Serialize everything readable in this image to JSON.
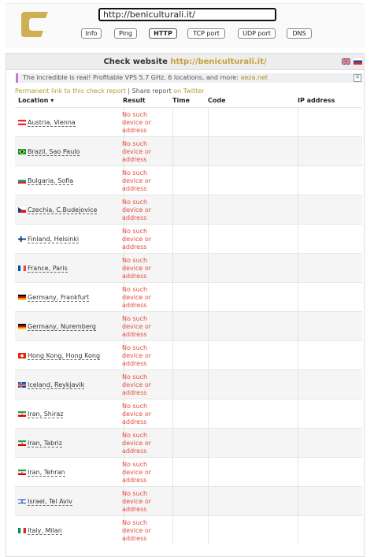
{
  "search": {
    "value": "http://beniculturali.it/"
  },
  "tools": [
    "Info",
    "Ping",
    "HTTP",
    "TCP port",
    "UDP port",
    "DNS"
  ],
  "active_tool": "HTTP",
  "title": {
    "prefix": "Check website",
    "host": "http://beniculturali.it/"
  },
  "ad": {
    "text": "The incredible is real! Profitable VPS 5.7 GHz, 6 locations, and more:",
    "link": "aeza.net"
  },
  "links": {
    "permanent": "Permanent link to this check report",
    "sep": "|",
    "share": "Share report",
    "twitter": "on Twitter"
  },
  "table": {
    "headers": {
      "location": "Location ▾",
      "result": "Result",
      "time": "Time",
      "code": "Code",
      "ip": "IP address"
    },
    "result_text": "No such device or address",
    "rows": [
      {
        "location": "Austria, Vienna",
        "flag": "at"
      },
      {
        "location": "Brazil, Sao Paulo",
        "flag": "br"
      },
      {
        "location": "Bulgaria, Sofia",
        "flag": "bg"
      },
      {
        "location": "Czechia, C.Budejovice",
        "flag": "cz"
      },
      {
        "location": "Finland, Helsinki",
        "flag": "fi"
      },
      {
        "location": "France, Paris",
        "flag": "fr"
      },
      {
        "location": "Germany, Frankfurt",
        "flag": "de"
      },
      {
        "location": "Germany, Nuremberg",
        "flag": "de"
      },
      {
        "location": "Hong Kong, Hong Kong",
        "flag": "hk"
      },
      {
        "location": "Iceland, Reykjavik",
        "flag": "is"
      },
      {
        "location": "Iran, Shiraz",
        "flag": "ir"
      },
      {
        "location": "Iran, Tabriz",
        "flag": "ir"
      },
      {
        "location": "Iran, Tehran",
        "flag": "ir"
      },
      {
        "location": "Israel, Tel Aviv",
        "flag": "il"
      },
      {
        "location": "Italy, Milan",
        "flag": "it"
      }
    ]
  },
  "colors": {
    "accent": "#c7a23c",
    "error": "#e64c3c"
  }
}
